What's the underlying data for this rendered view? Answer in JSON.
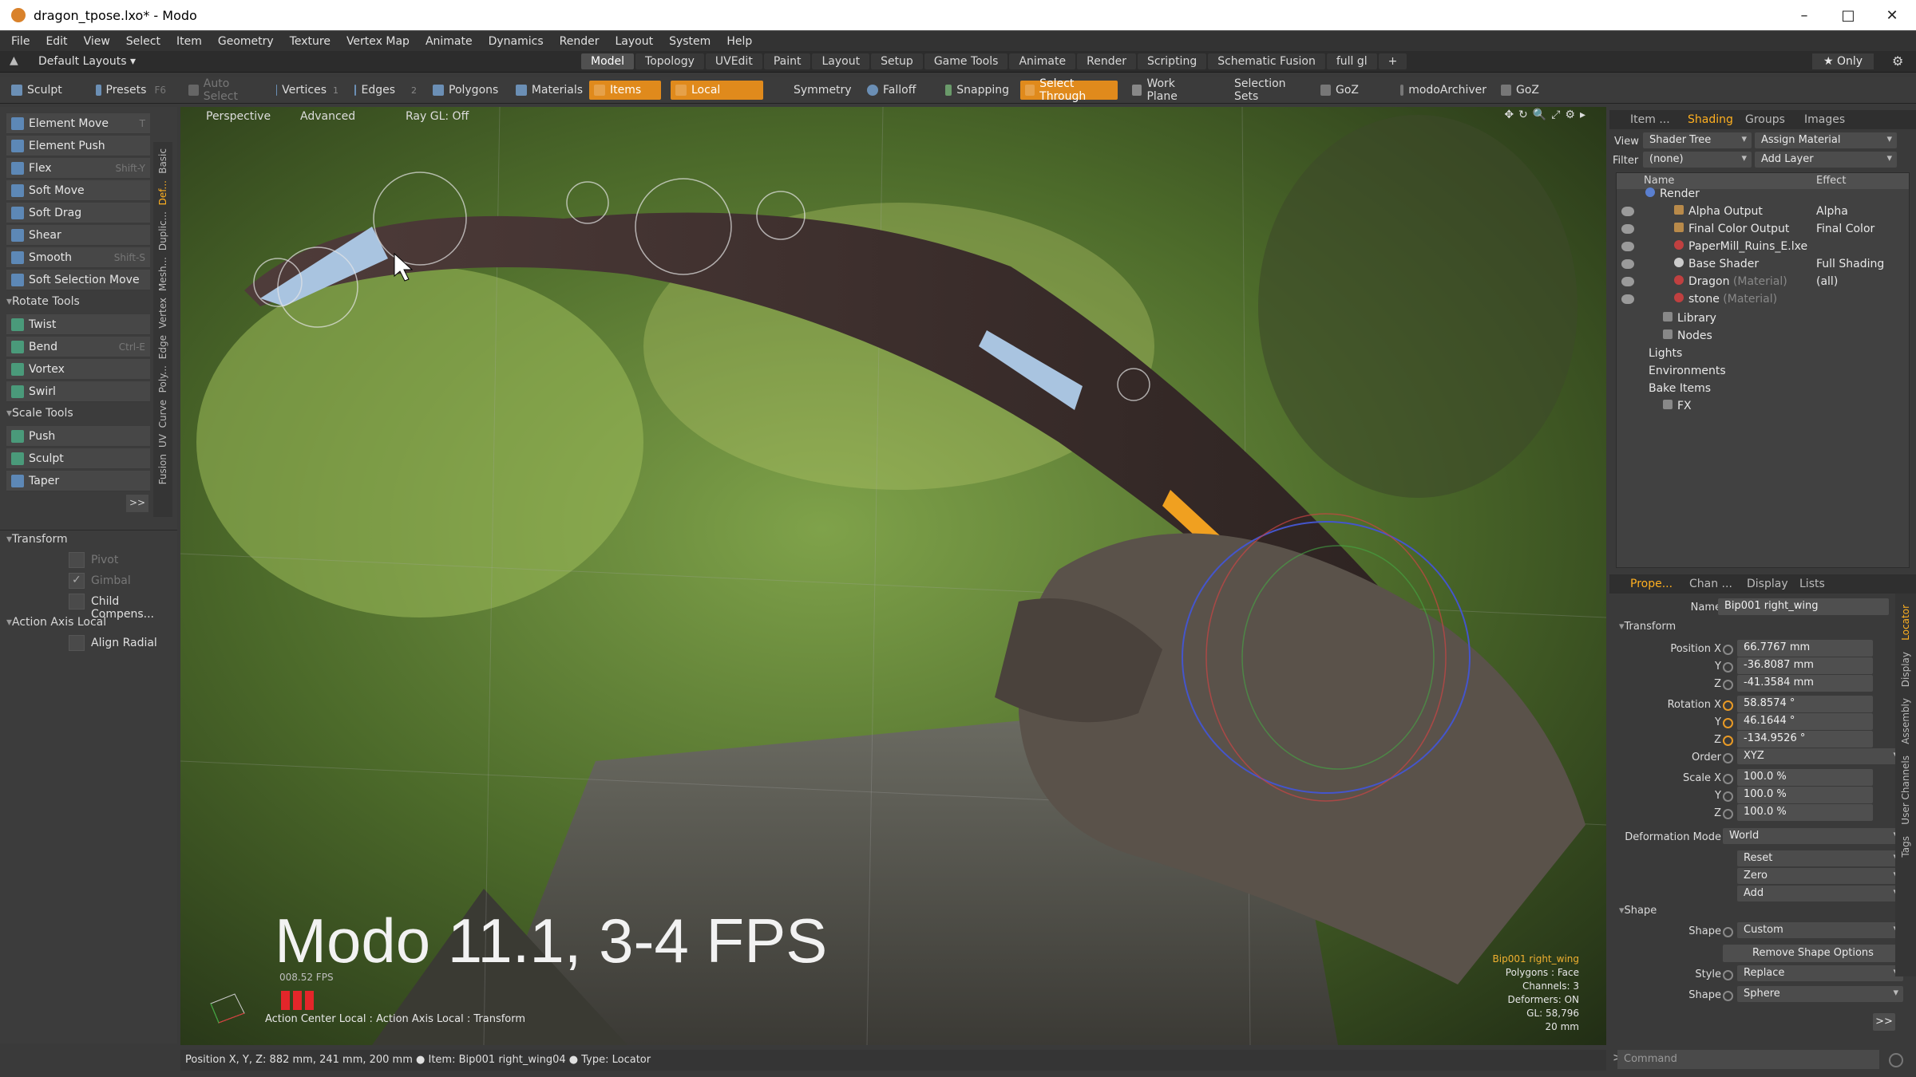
{
  "window": {
    "title": "dragon_tpose.lxo* - Modo",
    "minimize": "–",
    "maximize": "□",
    "close": "✕"
  },
  "menu": [
    "File",
    "Edit",
    "View",
    "Select",
    "Item",
    "Geometry",
    "Texture",
    "Vertex Map",
    "Animate",
    "Dynamics",
    "Render",
    "Layout",
    "System",
    "Help"
  ],
  "layouts": {
    "label": "Default Layouts ▾",
    "tabs": [
      "Model",
      "Topology",
      "UVEdit",
      "Paint",
      "Layout",
      "Setup",
      "Game Tools",
      "Animate",
      "Render",
      "Scripting",
      "Schematic Fusion",
      "full gl"
    ],
    "active_tab": "Model",
    "add": "+",
    "only": "★ Only"
  },
  "toolbar": {
    "sculpt": "Sculpt",
    "presets": "Presets",
    "presets_key": "F6",
    "auto_select": "Auto Select",
    "vertices": "Vertices",
    "vertices_n": "1",
    "edges": "Edges",
    "edges_n": "2",
    "polygons": "Polygons",
    "materials": "Materials",
    "items": "Items",
    "local": "Local",
    "symmetry": "Symmetry",
    "falloff": "Falloff",
    "snapping": "Snapping",
    "select_through": "Select Through",
    "work_plane": "Work Plane",
    "selection_sets": "Selection Sets",
    "goz1": "GoZ",
    "modo_archiver": "modoArchiver",
    "goz2": "GoZ"
  },
  "left": {
    "tools1": [
      {
        "label": "Element Move",
        "key": "T"
      },
      {
        "label": "Element Push",
        "key": ""
      },
      {
        "label": "Flex",
        "key": "Shift-Y"
      },
      {
        "label": "Soft Move",
        "key": ""
      },
      {
        "label": "Soft Drag",
        "key": ""
      },
      {
        "label": "Shear",
        "key": ""
      },
      {
        "label": "Smooth",
        "key": "Shift-S"
      },
      {
        "label": "Soft Selection Move",
        "key": ""
      }
    ],
    "rotate_tools": "Rotate Tools",
    "tools2": [
      {
        "label": "Twist",
        "key": ""
      },
      {
        "label": "Bend",
        "key": "Ctrl-E"
      },
      {
        "label": "Vortex",
        "key": ""
      },
      {
        "label": "Swirl",
        "key": ""
      }
    ],
    "scale_tools": "Scale Tools",
    "tools3": [
      {
        "label": "Push",
        "key": ""
      },
      {
        "label": "Sculpt",
        "key": ""
      },
      {
        "label": "Taper",
        "key": ""
      }
    ],
    "more": ">>",
    "transform": "Transform",
    "pivot": "Pivot",
    "gimbal": "Gimbal",
    "child_comp": "Child Compens...",
    "action_axis": "Action Axis Local",
    "align_radial": "Align Radial",
    "sidetabs": [
      "Basic",
      "Def...",
      "Duplic...",
      "Mesh...",
      "Vertex",
      "Edge",
      "Poly...",
      "Curve",
      "UV",
      "Fusion"
    ]
  },
  "viewport": {
    "perspective": "Perspective",
    "advanced": "Advanced",
    "raygl": "Ray GL: Off",
    "big_text": "Modo 11.1, 3-4 FPS",
    "fps": "008.52 FPS",
    "action_center": "Action Center Local : Action Axis Local : Transform",
    "info": [
      "Bip001 right_wing",
      "Polygons : Face",
      "Channels: 3",
      "Deformers: ON",
      "GL: 58,796",
      "20 mm"
    ]
  },
  "status": "Position X, Y, Z:  882 mm, 241 mm, 200 mm  ●  Item:  Bip001 right_wing04  ●  Type:  Locator",
  "right": {
    "tabs_top": [
      "Item ...",
      "Shading",
      "Groups",
      "Images"
    ],
    "view_label": "View",
    "view_value": "Shader Tree",
    "assign": "Assign Material",
    "filter_label": "Filter",
    "filter_value": "(none)",
    "add_layer": "Add Layer",
    "col_name": "Name",
    "col_effect": "Effect",
    "tree": [
      {
        "name": "Render",
        "extra": "",
        "effect": "",
        "indent": 0,
        "color": "#5a7fd0"
      },
      {
        "name": "Alpha Output",
        "extra": "",
        "effect": "Alpha",
        "indent": 2,
        "color": "#b88a4a"
      },
      {
        "name": "Final Color Output",
        "extra": "",
        "effect": "Final Color",
        "indent": 2,
        "color": "#b88a4a"
      },
      {
        "name": "PaperMill_Ruins_E.lxe",
        "extra": "",
        "effect": "",
        "indent": 2,
        "color": "#c04040"
      },
      {
        "name": "Base Shader",
        "extra": "",
        "effect": "Full Shading",
        "indent": 2,
        "color": "#cccccc"
      },
      {
        "name": "Dragon",
        "extra": "(Material)",
        "effect": "(all)",
        "indent": 2,
        "color": "#c04040"
      },
      {
        "name": "stone",
        "extra": "(Material)",
        "effect": "",
        "indent": 2,
        "color": "#c04040"
      },
      {
        "name": "Library",
        "extra": "",
        "effect": "",
        "indent": 1,
        "color": "#888888"
      },
      {
        "name": "Nodes",
        "extra": "",
        "effect": "",
        "indent": 1,
        "color": "#888888"
      },
      {
        "name": "Lights",
        "extra": "",
        "effect": "",
        "indent": 0,
        "color": ""
      },
      {
        "name": "Environments",
        "extra": "",
        "effect": "",
        "indent": 0,
        "color": ""
      },
      {
        "name": "Bake Items",
        "extra": "",
        "effect": "",
        "indent": 0,
        "color": ""
      },
      {
        "name": "FX",
        "extra": "",
        "effect": "",
        "indent": 1,
        "color": "#888888"
      }
    ],
    "tabs_bottom": [
      "Prope...",
      "Chan ...",
      "Display",
      "Lists"
    ],
    "name_label": "Name",
    "name_value": "Bip001 right_wing",
    "transform": "Transform",
    "pos_label": "Position X",
    "pos": [
      "66.7767 mm",
      "-36.8087 mm",
      "-41.3584 mm"
    ],
    "rot_label": "Rotation X",
    "rot": [
      "58.8574 °",
      "46.1644 °",
      "-134.9526 °"
    ],
    "y": "Y",
    "z": "Z",
    "order_label": "Order",
    "order": "XYZ",
    "scale_label": "Scale X",
    "scale": [
      "100.0 %",
      "100.0 %",
      "100.0 %"
    ],
    "defmode_label": "Deformation Mode",
    "defmode": "World",
    "reset": "Reset",
    "zero": "Zero",
    "add": "Add",
    "shape_sect": "Shape",
    "shape_label": "Shape",
    "shape_value": "Custom",
    "remove_shape": "Remove Shape Options",
    "style_label": "Style",
    "style_value": "Replace",
    "shape2_value": "Sphere",
    "more": ">>",
    "vtabs": [
      "Locator",
      "Display",
      "Assembly",
      "User Channels",
      "Tags"
    ],
    "command": "Command"
  }
}
